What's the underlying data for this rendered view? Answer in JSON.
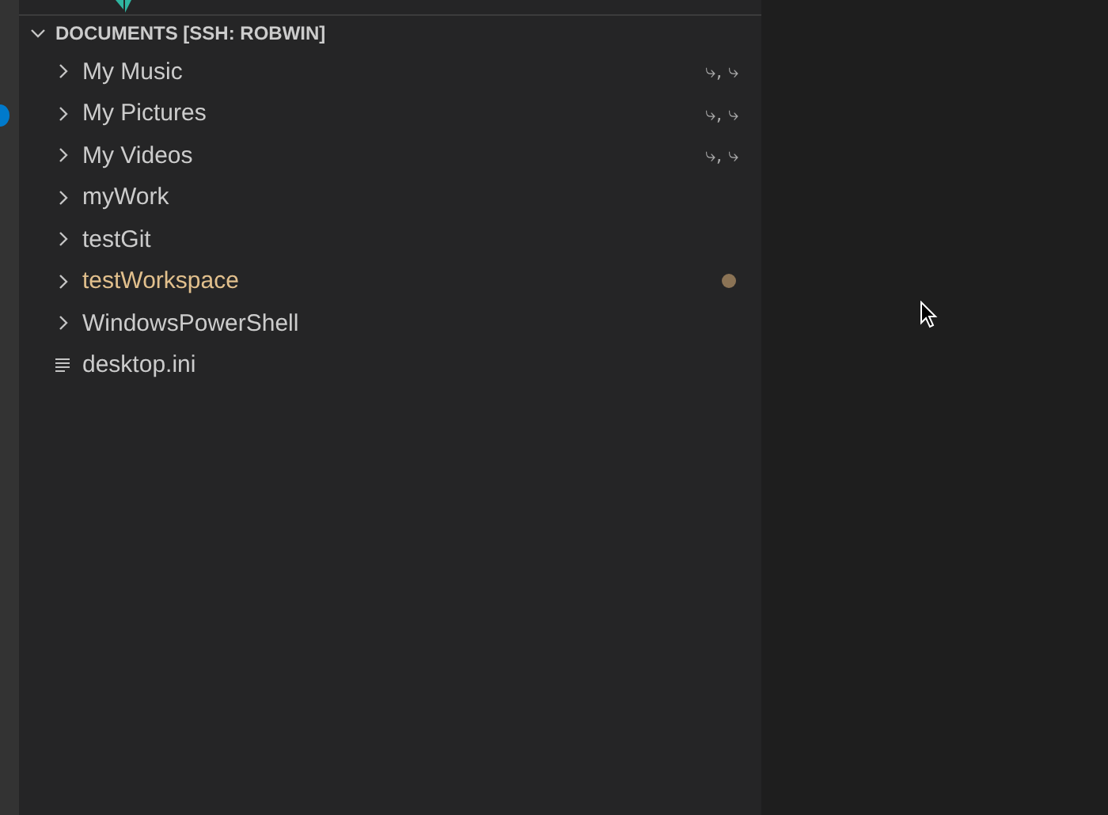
{
  "explorer": {
    "section_title": "DOCUMENTS [SSH: ROBWIN]",
    "expanded": true,
    "items": [
      {
        "kind": "folder",
        "name": "My Music",
        "modified": false,
        "decoration": "⤷, ⤷"
      },
      {
        "kind": "folder",
        "name": "My Pictures",
        "modified": false,
        "decoration": "⤷, ⤷"
      },
      {
        "kind": "folder",
        "name": "My Videos",
        "modified": false,
        "decoration": "⤷, ⤷"
      },
      {
        "kind": "folder",
        "name": "myWork",
        "modified": false
      },
      {
        "kind": "folder",
        "name": "testGit",
        "modified": false
      },
      {
        "kind": "folder",
        "name": "testWorkspace",
        "modified": true
      },
      {
        "kind": "folder",
        "name": "WindowsPowerShell",
        "modified": false
      },
      {
        "kind": "file",
        "name": "desktop.ini",
        "modified": false
      }
    ]
  }
}
